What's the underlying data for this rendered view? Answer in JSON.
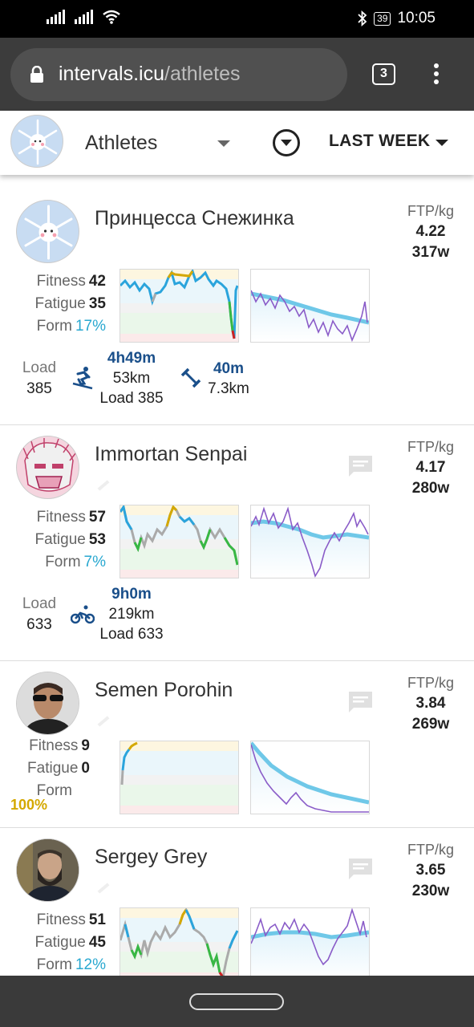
{
  "status": {
    "time": "10:05",
    "battery": "39"
  },
  "browser": {
    "domain": "intervals.icu",
    "path": "/athletes",
    "tab_count": "3"
  },
  "appbar": {
    "title": "Athletes",
    "period": "LAST WEEK"
  },
  "colors": {
    "form_blue": "#29a8d0",
    "form_yellow": "#d4a800",
    "duration_blue": "#1a4f8a",
    "fitness_line": "#6fc8e8",
    "power_line": "#8a5cc8"
  },
  "athletes": [
    {
      "name": "Принцесса Снежинка",
      "ftp_label": "FTP/kg",
      "ftp_kg": "4.22",
      "ftp_w": "317w",
      "fitness_label": "Fitness",
      "fitness": "42",
      "fatigue_label": "Fatigue",
      "fatigue": "35",
      "form_label": "Form",
      "form": "17%",
      "load_label": "Load",
      "load": "385",
      "activities": [
        {
          "icon": "ski-icon",
          "duration": "4h49m",
          "distance": "53km",
          "load": "Load 385"
        },
        {
          "icon": "strength-icon",
          "duration": "40m",
          "distance": "7.3km"
        }
      ]
    },
    {
      "name": "Immortan Senpai",
      "ftp_label": "FTP/kg",
      "ftp_kg": "4.17",
      "ftp_w": "280w",
      "fitness_label": "Fitness",
      "fitness": "57",
      "fatigue_label": "Fatigue",
      "fatigue": "53",
      "form_label": "Form",
      "form": "7%",
      "load_label": "Load",
      "load": "633",
      "activities": [
        {
          "icon": "bike-icon",
          "duration": "9h0m",
          "distance": "219km",
          "load": "Load 633"
        }
      ]
    },
    {
      "name": "Semen Porohin",
      "ftp_label": "FTP/kg",
      "ftp_kg": "3.84",
      "ftp_w": "269w",
      "fitness_label": "Fitness",
      "fitness": "9",
      "fatigue_label": "Fatigue",
      "fatigue": "0",
      "form_label": "Form",
      "form": "100%"
    },
    {
      "name": "Sergey Grey",
      "ftp_label": "FTP/kg",
      "ftp_kg": "3.65",
      "ftp_w": "230w",
      "fitness_label": "Fitness",
      "fitness": "51",
      "fatigue_label": "Fatigue",
      "fatigue": "45",
      "form_label": "Form",
      "form": "12%"
    }
  ]
}
